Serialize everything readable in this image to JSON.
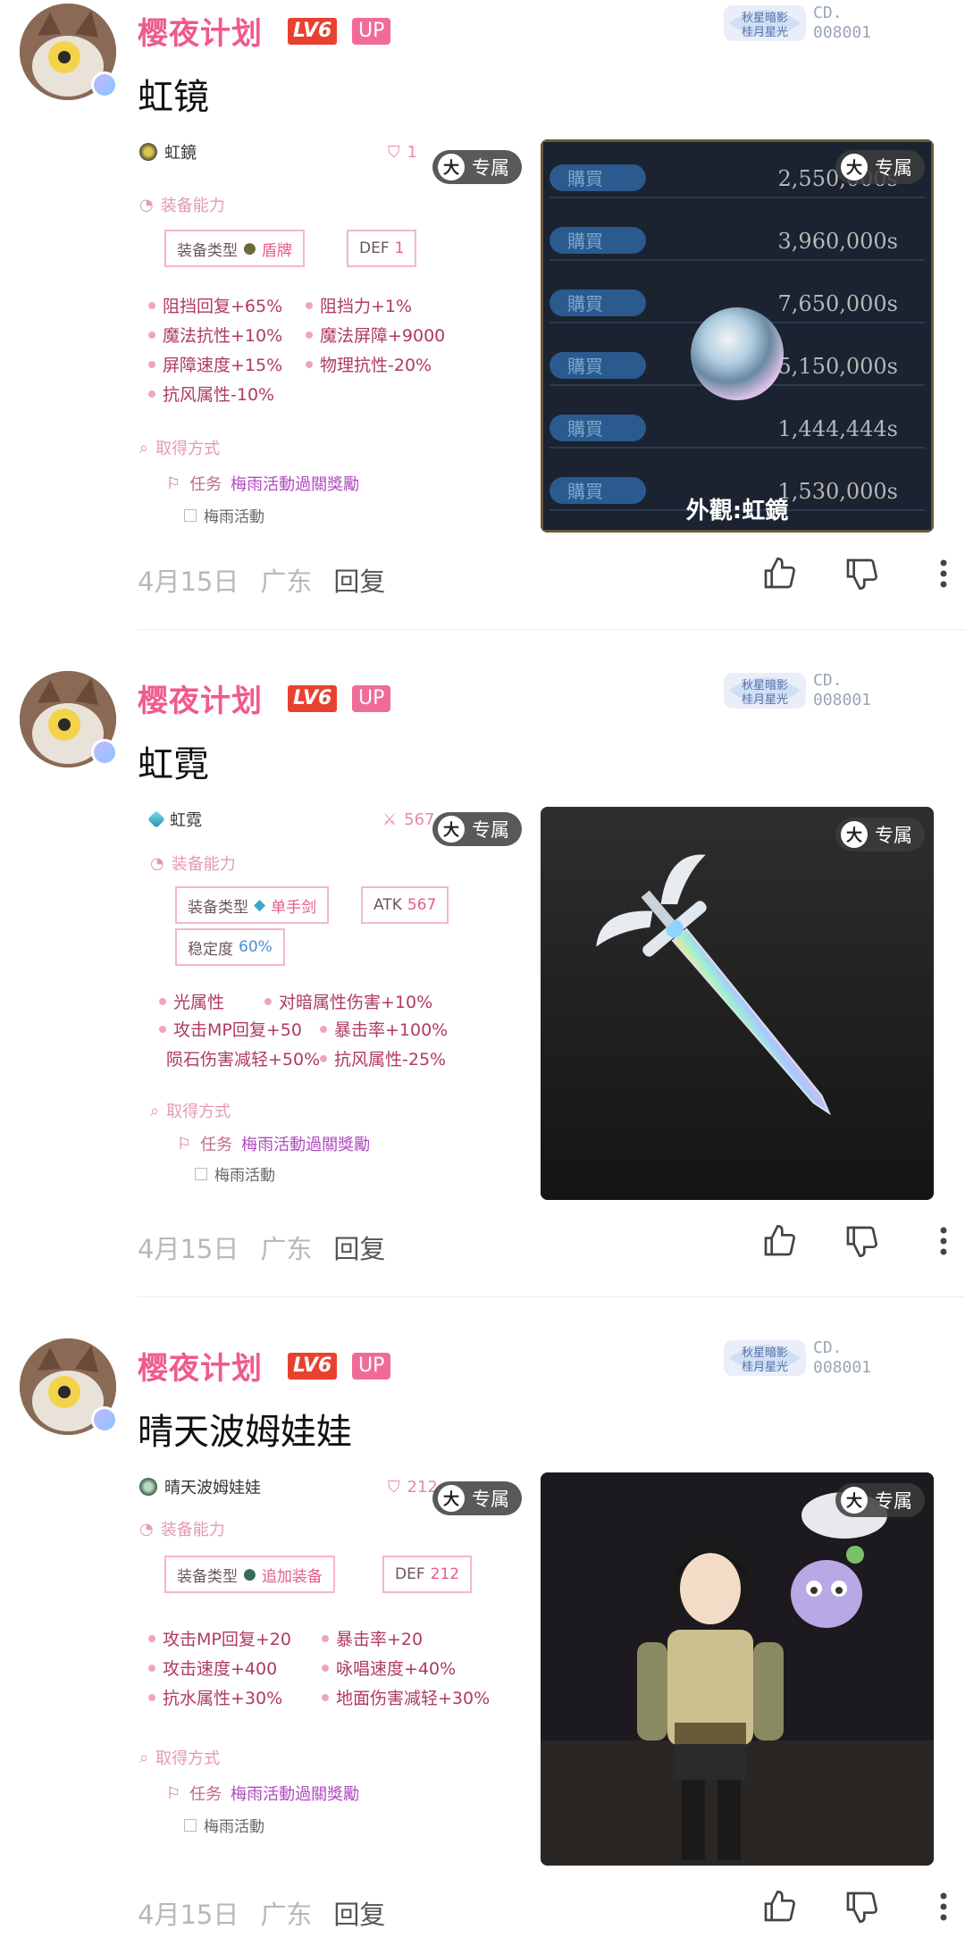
{
  "posts": [
    {
      "username": "樱夜计划",
      "level": "LV6",
      "up": "UP",
      "badge_id": "CD.\n008001",
      "title": "虹镜",
      "item": {
        "name": "虹鏡",
        "top_stat": "1",
        "section_ability": "装备能力",
        "tags": [
          {
            "label": "装备类型",
            "value": "盾牌",
            "blue": false
          },
          {
            "label": "DEF",
            "value": "1",
            "blue": false
          }
        ],
        "attrs": [
          "阻挡回复+65%",
          "阻挡力+1%",
          "魔法抗性+10%",
          "魔法屏障+9000",
          "屏障速度+15%",
          "物理抗性-20%",
          "抗风属性-10%"
        ],
        "section_obtain": "取得方式",
        "task_label": "任务",
        "task_link": "梅雨活動過關獎勵",
        "sub": "梅雨活動"
      },
      "exclusive": {
        "big": "大",
        "label": "专属"
      },
      "photo_caption": "外觀:虹鏡",
      "shop_prices": [
        "2,550,000s",
        "3,960,000s",
        "7,650,000s",
        "5,150,000s",
        "1,444,444s",
        "1,530,000s"
      ],
      "shop_buy": "購買",
      "date": "4月15日",
      "location": "广东",
      "reply": "回复"
    },
    {
      "username": "樱夜计划",
      "level": "LV6",
      "up": "UP",
      "badge_id": "CD.\n008001",
      "title": "虹霓",
      "item": {
        "name": "虹霓",
        "top_stat": "567",
        "section_ability": "装备能力",
        "tags": [
          {
            "label": "装备类型",
            "value": "单手剑",
            "blue": false
          },
          {
            "label": "ATK",
            "value": "567",
            "blue": false
          },
          {
            "label": "稳定度",
            "value": "60%",
            "blue": true
          }
        ],
        "attrs": [
          "光属性",
          "对暗属性伤害+10%",
          "攻击MP回复+50",
          "暴击率+100%",
          "陨石伤害减轻+50%",
          "抗风属性-25%"
        ],
        "section_obtain": "取得方式",
        "task_label": "任务",
        "task_link": "梅雨活動過關獎勵",
        "sub": "梅雨活動"
      },
      "exclusive": {
        "big": "大",
        "label": "专属"
      },
      "date": "4月15日",
      "location": "广东",
      "reply": "回复"
    },
    {
      "username": "樱夜计划",
      "level": "LV6",
      "up": "UP",
      "badge_id": "CD.\n008001",
      "title": "晴天波姆娃娃",
      "item": {
        "name": "晴天波姆娃娃",
        "top_stat": "212",
        "section_ability": "装备能力",
        "tags": [
          {
            "label": "装备类型",
            "value": "追加装备",
            "blue": false
          },
          {
            "label": "DEF",
            "value": "212",
            "blue": false
          }
        ],
        "attrs": [
          "攻击MP回复+20",
          "暴击率+20",
          "攻击速度+400",
          "咏唱速度+40%",
          "抗水属性+30%",
          "地面伤害减轻+30%"
        ],
        "section_obtain": "取得方式",
        "task_label": "任务",
        "task_link": "梅雨活動過關獎勵",
        "sub": "梅雨活動"
      },
      "exclusive": {
        "big": "大",
        "label": "专属"
      },
      "date": "4月15日",
      "location": "广东",
      "reply": "回复"
    }
  ]
}
